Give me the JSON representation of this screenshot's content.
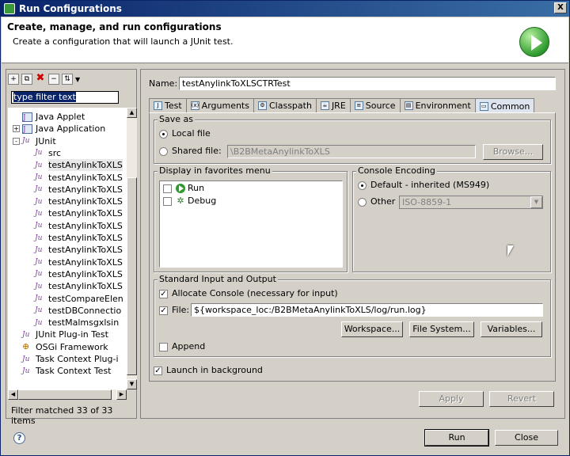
{
  "window": {
    "title": "Run Configurations",
    "close_glyph": "X"
  },
  "banner": {
    "heading": "Create, manage, and run configurations",
    "subtitle": "Create a configuration that will launch a JUnit test."
  },
  "left": {
    "filter_text": "type filter text",
    "tree": [
      {
        "label": "Java Applet",
        "icon": "J",
        "indent": 1
      },
      {
        "label": "Java Application",
        "icon": "J",
        "indent": 1,
        "expander": "+"
      },
      {
        "label": "JUnit",
        "icon": "Ju",
        "indent": 1,
        "expander": "-"
      },
      {
        "label": "src",
        "icon": "Ju",
        "indent": 2
      },
      {
        "label": "testAnylinkToXLS",
        "icon": "Ju",
        "indent": 2,
        "selected": true
      },
      {
        "label": "testAnylinkToXLS",
        "icon": "Ju",
        "indent": 2
      },
      {
        "label": "testAnylinkToXLS",
        "icon": "Ju",
        "indent": 2
      },
      {
        "label": "testAnylinkToXLS",
        "icon": "Ju",
        "indent": 2
      },
      {
        "label": "testAnylinkToXLS",
        "icon": "Ju",
        "indent": 2
      },
      {
        "label": "testAnylinkToXLS",
        "icon": "Ju",
        "indent": 2
      },
      {
        "label": "testAnylinkToXLS",
        "icon": "Ju",
        "indent": 2
      },
      {
        "label": "testAnylinkToXLS",
        "icon": "Ju",
        "indent": 2
      },
      {
        "label": "testAnylinkToXLS",
        "icon": "Ju",
        "indent": 2
      },
      {
        "label": "testAnylinkToXLS",
        "icon": "Ju",
        "indent": 2
      },
      {
        "label": "testAnylinkToXLS",
        "icon": "Ju",
        "indent": 2
      },
      {
        "label": "testCompareElen",
        "icon": "Ju",
        "indent": 2
      },
      {
        "label": "testDBConnectio",
        "icon": "Ju",
        "indent": 2
      },
      {
        "label": "testMalmsgxlsin",
        "icon": "Ju",
        "indent": 2
      },
      {
        "label": "JUnit Plug-in Test",
        "icon": "Ju",
        "indent": 1
      },
      {
        "label": "OSGi Framework",
        "icon": "⊕",
        "indent": 1
      },
      {
        "label": "Task Context Plug-i",
        "icon": "Ju",
        "indent": 1
      },
      {
        "label": "Task Context Test",
        "icon": "Ju",
        "indent": 1
      }
    ],
    "matched_text": "Filter matched 33 of 33 items"
  },
  "right": {
    "name_label": "Name:",
    "name_value": "testAnylinkToXLSCTRTest",
    "tabs": [
      {
        "label": "Test",
        "icon": "test-icon"
      },
      {
        "label": "Arguments",
        "icon": "arguments-icon"
      },
      {
        "label": "Classpath",
        "icon": "classpath-icon"
      },
      {
        "label": "JRE",
        "icon": "jre-icon"
      },
      {
        "label": "Source",
        "icon": "source-icon"
      },
      {
        "label": "Environment",
        "icon": "environment-icon"
      },
      {
        "label": "Common",
        "icon": "common-icon",
        "active": true
      }
    ],
    "save_as": {
      "title": "Save as",
      "local_label": "Local file",
      "shared_label": "Shared file:",
      "shared_value": "\\B2BMetaAnylinkToXLS",
      "browse_label": "Browse..."
    },
    "favorites": {
      "title": "Display in favorites menu",
      "items": [
        "Run",
        "Debug"
      ]
    },
    "console_encoding": {
      "title": "Console Encoding",
      "default_label": "Default - inherited (MS949)",
      "other_label": "Other",
      "other_value": "ISO-8859-1"
    },
    "std_io": {
      "title": "Standard Input and Output",
      "allocate_label": "Allocate Console (necessary for input)",
      "file_label": "File:",
      "file_value": "${workspace_loc:/B2BMetaAnylinkToXLS/log/run.log}",
      "workspace_btn": "Workspace...",
      "filesystem_btn": "File System...",
      "variables_btn": "Variables...",
      "append_label": "Append"
    },
    "launch_bg_label": "Launch in background",
    "apply_label": "Apply",
    "revert_label": "Revert"
  },
  "footer": {
    "help_glyph": "?",
    "run_label": "Run",
    "close_label": "Close"
  },
  "colors": {
    "title_bar": "#0a246a",
    "dialog_bg": "#d4d0c8",
    "run_green": "#2e9a2e"
  }
}
